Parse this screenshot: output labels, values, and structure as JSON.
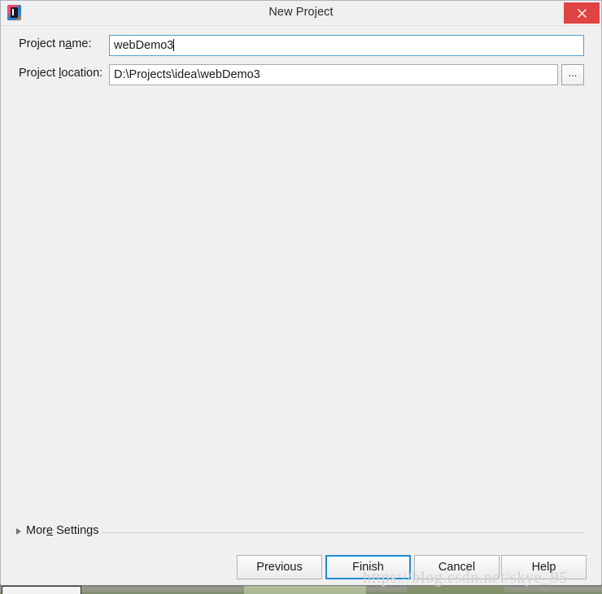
{
  "window": {
    "title": "New Project",
    "app_icon": "intellij-idea-icon",
    "close_label": "×"
  },
  "form": {
    "fields": [
      {
        "id": "project-name",
        "label_before": "Project n",
        "label_mnemonic": "a",
        "label_after": "me:",
        "value": "webDemo3",
        "placeholder": "",
        "focused": true,
        "has_browse": false
      },
      {
        "id": "project-location",
        "label_before": "Project ",
        "label_mnemonic": "l",
        "label_after": "ocation:",
        "value": "D:\\Projects\\idea\\webDemo3",
        "placeholder": "",
        "focused": false,
        "has_browse": true,
        "browse_label": "..."
      }
    ]
  },
  "more_settings": {
    "label_before": "Mor",
    "label_mnemonic": "e",
    "label_after": " Settings",
    "expanded": false,
    "arrow_icon": "triangle-right-icon"
  },
  "buttons": [
    {
      "id": "previous",
      "label": "Previous",
      "default": false
    },
    {
      "id": "finish",
      "label": "Finish",
      "default": true
    },
    {
      "id": "cancel",
      "label": "Cancel",
      "default": false
    },
    {
      "id": "help",
      "label": "Help",
      "default": false
    }
  ],
  "watermark": {
    "text": "https://blog.csdn.net/skye_95"
  },
  "colors": {
    "dialog_background": "#f0f0f0",
    "close_button": "#e04343",
    "focus_border": "#4fa3cd",
    "default_button_border": "#1e8bd4",
    "text": "#1a1a1a",
    "separator": "#cfcfcf"
  }
}
